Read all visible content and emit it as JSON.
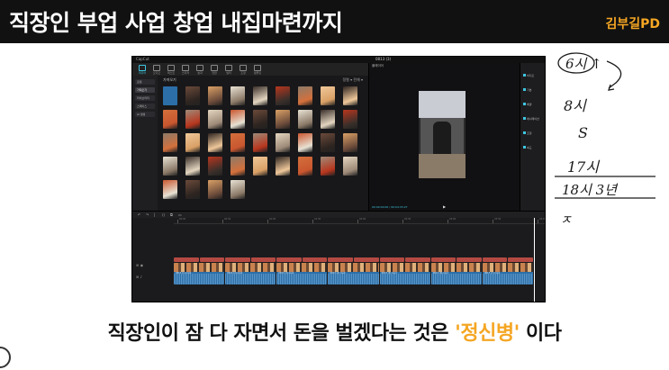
{
  "banner": {
    "title": "직장인 부업 사업 창업 내집마련까지",
    "channel": "김부길PD",
    "channel_color": "#f5a623"
  },
  "editor": {
    "app_name": "CapCut",
    "project_name": "0813 (3)",
    "toolbar": [
      {
        "label": "미디어",
        "icon": "media-icon",
        "active": true
      },
      {
        "label": "오디오",
        "icon": "audio-icon",
        "active": false
      },
      {
        "label": "텍스트",
        "icon": "text-icon",
        "active": false
      },
      {
        "label": "스티커",
        "icon": "sticker-icon",
        "active": false
      },
      {
        "label": "효과",
        "icon": "effects-icon",
        "active": false
      },
      {
        "label": "전환",
        "icon": "transition-icon",
        "active": false
      },
      {
        "label": "필터",
        "icon": "filter-icon",
        "active": false
      },
      {
        "label": "조정",
        "icon": "adjust-icon",
        "active": false
      },
      {
        "label": "템플릿",
        "icon": "template-icon",
        "active": false
      }
    ],
    "sidebar": [
      "로컬",
      "가져오기",
      "라이브러리",
      "스페이스",
      "AI 생성"
    ],
    "media_label": "가져오기",
    "media_controls": "정렬 ▾  전체 ▾",
    "player_header": "플레이어",
    "timecode": "00:00:00:00 / 00:04:33:27",
    "properties": [
      "비디오",
      "기본",
      "배경",
      "애니메이션",
      "조정",
      "속도"
    ],
    "timeline_tools": [
      "↶",
      "↷",
      "|",
      "⟨⟩",
      "⧉",
      "▭"
    ],
    "ruler_labels": [
      "00:00",
      "00:30",
      "01:00",
      "01:30",
      "02:00",
      "02:30",
      "03:00",
      "03:30",
      "04:00"
    ],
    "clip_labels": [
      "0813 (1).mp4",
      "0813 (2).mp4",
      "0813 (3).mp4",
      "0813 (4).mp4",
      "0813 (5).mp4",
      "0813 (6).mp4",
      "0813 (7).mp4"
    ]
  },
  "handwriting": {
    "line1": "6시 ↑",
    "line2": "8시",
    "line3": "S",
    "line4": "17시",
    "line5": "18시 3년",
    "line6": "ㅈ"
  },
  "caption": {
    "before": "직장인이 잠 다 자면서 돈을 벌겠다는 것은 ",
    "highlight": "'정신병'",
    "after": " 이다",
    "highlight_color": "#f5a623"
  }
}
